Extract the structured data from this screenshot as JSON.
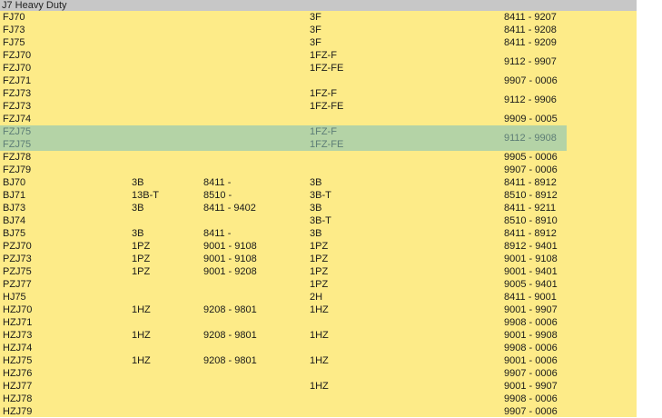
{
  "header": {
    "title": "J7 Heavy Duty"
  },
  "colors": {
    "background": "#fdeb88",
    "header": "#c7c7c7",
    "highlight": "#b4d3a6"
  },
  "rows": [
    {
      "model": [
        "FJ70"
      ],
      "engine": "",
      "engine_range": "",
      "engine2": [
        "3F"
      ],
      "range": "8411 - 9207",
      "highlight": false
    },
    {
      "model": [
        "FJ73"
      ],
      "engine": "",
      "engine_range": "",
      "engine2": [
        "3F"
      ],
      "range": "8411 - 9208",
      "highlight": false
    },
    {
      "model": [
        "FJ75"
      ],
      "engine": "",
      "engine_range": "",
      "engine2": [
        "3F"
      ],
      "range": "8411 - 9209",
      "highlight": false
    },
    {
      "model": [
        "FZJ70",
        "FZJ70"
      ],
      "engine": "",
      "engine_range": "",
      "engine2": [
        "1FZ-F",
        "1FZ-FE"
      ],
      "range": "9112 - 9907",
      "highlight": false
    },
    {
      "model": [
        "FZJ71"
      ],
      "engine": "",
      "engine_range": "",
      "engine2": [
        ""
      ],
      "range": "9907 - 0006",
      "highlight": false
    },
    {
      "model": [
        "FZJ73",
        "FZJ73"
      ],
      "engine": "",
      "engine_range": "",
      "engine2": [
        "1FZ-F",
        "1FZ-FE"
      ],
      "range": "9112 - 9906",
      "highlight": false
    },
    {
      "model": [
        "FZJ74"
      ],
      "engine": "",
      "engine_range": "",
      "engine2": [
        ""
      ],
      "range": "9909 - 0005",
      "highlight": false
    },
    {
      "model": [
        "FZJ75",
        "FZJ75"
      ],
      "engine": "",
      "engine_range": "",
      "engine2": [
        "1FZ-F",
        "1FZ-FE"
      ],
      "range": "9112 - 9908",
      "highlight": true
    },
    {
      "model": [
        "FZJ78"
      ],
      "engine": "",
      "engine_range": "",
      "engine2": [
        ""
      ],
      "range": "9905 - 0006",
      "highlight": false
    },
    {
      "model": [
        "FZJ79"
      ],
      "engine": "",
      "engine_range": "",
      "engine2": [
        ""
      ],
      "range": "9907 - 0006",
      "highlight": false
    },
    {
      "model": [
        "BJ70"
      ],
      "engine": "3B",
      "engine_range": "8411 -",
      "engine2": [
        "3B"
      ],
      "range": "8411 - 8912",
      "highlight": false
    },
    {
      "model": [
        "BJ71"
      ],
      "engine": "13B-T",
      "engine_range": "8510 -",
      "engine2": [
        "3B-T"
      ],
      "range": "8510 - 8912",
      "highlight": false
    },
    {
      "model": [
        "BJ73"
      ],
      "engine": "3B",
      "engine_range": "8411 - 9402",
      "engine2": [
        "3B"
      ],
      "range": "8411 - 9211",
      "highlight": false
    },
    {
      "model": [
        "BJ74"
      ],
      "engine": "",
      "engine_range": "",
      "engine2": [
        "3B-T"
      ],
      "range": "8510 - 8910",
      "highlight": false
    },
    {
      "model": [
        "BJ75"
      ],
      "engine": "3B",
      "engine_range": "8411 -",
      "engine2": [
        "3B"
      ],
      "range": "8411 - 8912",
      "highlight": false
    },
    {
      "model": [
        "PZJ70"
      ],
      "engine": "1PZ",
      "engine_range": "9001 - 9108",
      "engine2": [
        "1PZ"
      ],
      "range": "8912 - 9401",
      "highlight": false
    },
    {
      "model": [
        "PZJ73"
      ],
      "engine": "1PZ",
      "engine_range": "9001 - 9108",
      "engine2": [
        "1PZ"
      ],
      "range": "9001 - 9108",
      "highlight": false
    },
    {
      "model": [
        "PZJ75"
      ],
      "engine": "1PZ",
      "engine_range": "9001 - 9208",
      "engine2": [
        "1PZ"
      ],
      "range": "9001 - 9401",
      "highlight": false
    },
    {
      "model": [
        "PZJ77"
      ],
      "engine": "",
      "engine_range": "",
      "engine2": [
        "1PZ"
      ],
      "range": "9005 - 9401",
      "highlight": false
    },
    {
      "model": [
        "HJ75"
      ],
      "engine": "",
      "engine_range": "",
      "engine2": [
        "2H"
      ],
      "range": "8411 - 9001",
      "highlight": false
    },
    {
      "model": [
        "HZJ70"
      ],
      "engine": "1HZ",
      "engine_range": "9208 - 9801",
      "engine2": [
        "1HZ"
      ],
      "range": "9001 - 9907",
      "highlight": false
    },
    {
      "model": [
        "HZJ71"
      ],
      "engine": "",
      "engine_range": "",
      "engine2": [
        ""
      ],
      "range": "9908 - 0006",
      "highlight": false
    },
    {
      "model": [
        "HZJ73"
      ],
      "engine": "1HZ",
      "engine_range": "9208 - 9801",
      "engine2": [
        "1HZ"
      ],
      "range": "9001 - 9908",
      "highlight": false
    },
    {
      "model": [
        "HZJ74"
      ],
      "engine": "",
      "engine_range": "",
      "engine2": [
        ""
      ],
      "range": "9908 - 0006",
      "highlight": false
    },
    {
      "model": [
        "HZJ75"
      ],
      "engine": "1HZ",
      "engine_range": "9208 - 9801",
      "engine2": [
        "1HZ"
      ],
      "range": "9001 - 0006",
      "highlight": false
    },
    {
      "model": [
        "HZJ76"
      ],
      "engine": "",
      "engine_range": "",
      "engine2": [
        ""
      ],
      "range": "9907 - 0006",
      "highlight": false
    },
    {
      "model": [
        "HZJ77"
      ],
      "engine": "",
      "engine_range": "",
      "engine2": [
        "1HZ"
      ],
      "range": "9001 - 9907",
      "highlight": false
    },
    {
      "model": [
        "HZJ78"
      ],
      "engine": "",
      "engine_range": "",
      "engine2": [
        ""
      ],
      "range": "9908 - 0006",
      "highlight": false
    },
    {
      "model": [
        "HZJ79"
      ],
      "engine": "",
      "engine_range": "",
      "engine2": [
        ""
      ],
      "range": "9907 - 0006",
      "highlight": false
    }
  ]
}
